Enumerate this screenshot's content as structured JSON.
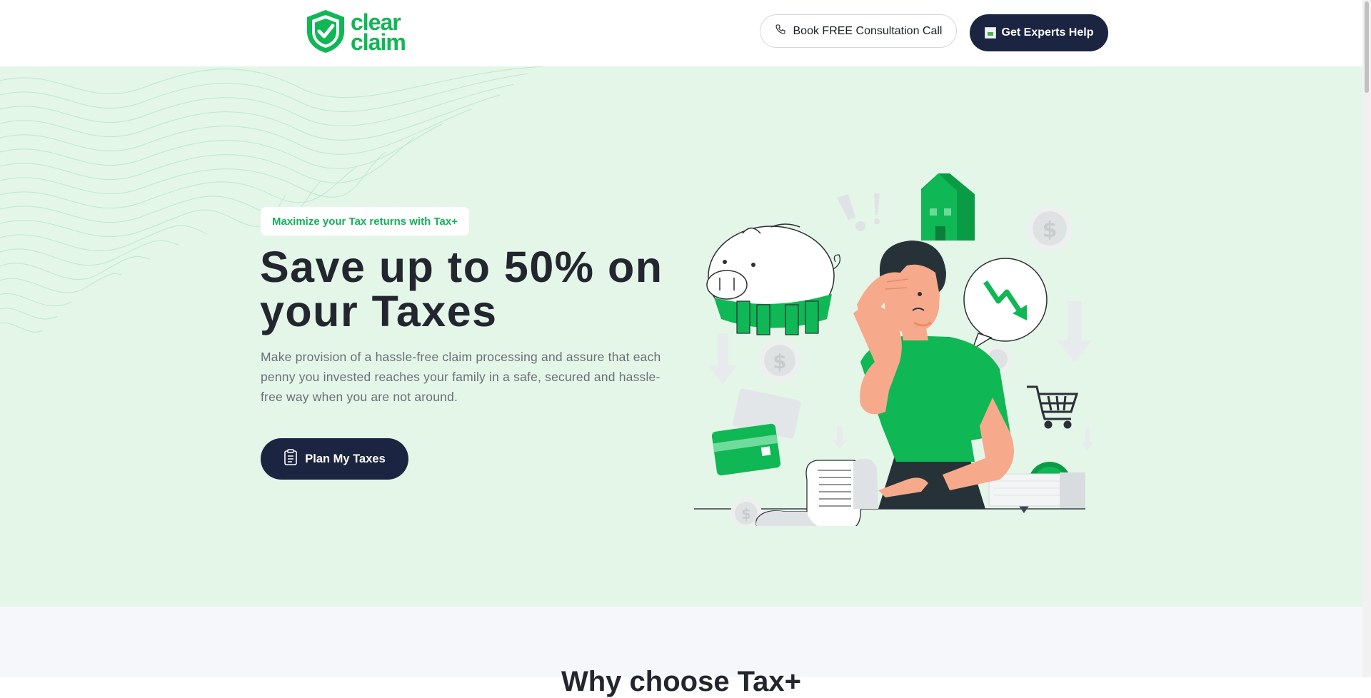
{
  "header": {
    "logo": {
      "line1": "clear",
      "line2": "claim",
      "icon": "shield-check-icon"
    },
    "consult_button": {
      "label": "Book FREE Consultation Call",
      "icon": "phone-icon"
    },
    "experts_button": {
      "label": "Get Experts Help",
      "icon": "broken-image-icon"
    }
  },
  "hero": {
    "badge": "Maximize your Tax returns with Tax+",
    "title": "Save up to 50% on your Taxes",
    "description": "Make provision of a hassle-free claim processing and assure that each penny you invested reaches your family in a safe, secured and hassle-free way when you are not around.",
    "cta": {
      "label": "Plan My Taxes",
      "icon": "document-list-icon"
    },
    "illustration": "stressed-man-with-bills-illustration"
  },
  "next_section": {
    "heading": "Why choose Tax+"
  },
  "colors": {
    "brand_green": "#10b755",
    "navy": "#1b2440",
    "hero_bg": "#e4f6e8",
    "section_bg": "#f6f7fb"
  }
}
